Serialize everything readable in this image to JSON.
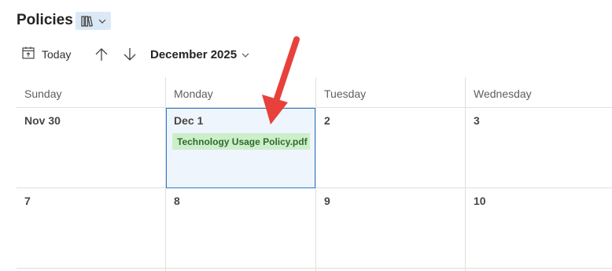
{
  "header": {
    "title": "Policies",
    "view_icon": "library-icon",
    "view_dropdown_icon": "chevron-down-icon"
  },
  "toolbar": {
    "today_label": "Today",
    "today_icon": "calendar-today-icon",
    "prev_icon": "arrow-up-icon",
    "next_icon": "arrow-down-icon",
    "month_label": "December 2025",
    "month_dropdown_icon": "chevron-down-icon"
  },
  "calendar": {
    "day_headers": [
      "Sunday",
      "Monday",
      "Tuesday",
      "Wednesday"
    ],
    "week1": [
      "Nov 30",
      "Dec 1",
      "2",
      "3"
    ],
    "week2": [
      "7",
      "8",
      "9",
      "10"
    ],
    "selected_day": "Dec 1",
    "events": [
      {
        "day": "Dec 1",
        "title": "Technology Usage Policy.pdf"
      }
    ]
  },
  "annotation": {
    "arrow_color": "#e8413c"
  },
  "colors": {
    "accent": "#2b79c9",
    "selected_background": "#eef5fc",
    "event_background": "#cdeecb",
    "event_text": "#2f6b2f"
  }
}
